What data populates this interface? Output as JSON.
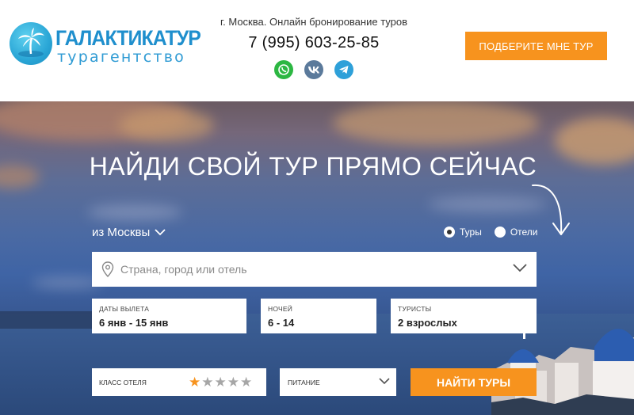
{
  "logo": {
    "name": "ГАЛАКТИКАТУР",
    "subtitle": "турагентство"
  },
  "header": {
    "tagline": "г. Москва. Онлайн бронирование туров",
    "phone": "7 (995) 603-25-85",
    "pick_button": "ПОДБЕРИТЕ МНЕ ТУР",
    "socials": [
      "whatsapp-icon",
      "vk-icon",
      "telegram-icon"
    ]
  },
  "hero": {
    "title": "НАЙДИ СВОЙ ТУР ПРЯМО СЕЙЧАС",
    "departure": "из Москвы",
    "search_type": {
      "options": [
        "Туры",
        "Отели"
      ],
      "selected": "Туры"
    },
    "search_placeholder": "Страна, город или отель",
    "fields": {
      "dates": {
        "label": "ДАТЫ ВЫЛЕТА",
        "value": "6 янв - 15 янв"
      },
      "nights": {
        "label": "НОЧЕЙ",
        "value": "6 - 14"
      },
      "tourists": {
        "label": "ТУРИСТЫ",
        "value": "2 взрослых"
      }
    },
    "hotel_class": {
      "label": "КЛАСС ОТЕЛЯ",
      "stars_total": 5,
      "stars_selected": 1
    },
    "meal": {
      "label": "ПИТАНИЕ"
    },
    "find_button": "НАЙТИ ТУРЫ"
  },
  "colors": {
    "accent": "#f7931e",
    "brand": "#1f8fcd"
  }
}
